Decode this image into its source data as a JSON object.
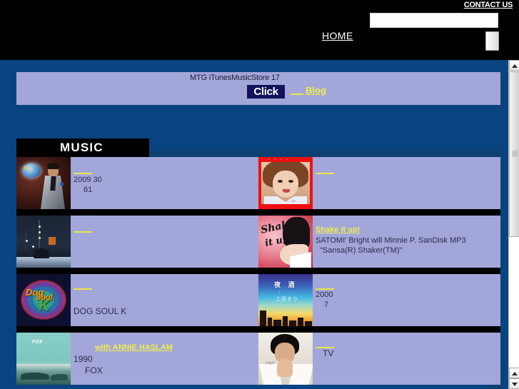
{
  "header": {
    "contact_label": "CONTACT US",
    "home_label": "HOME",
    "search_value": "",
    "search_placeholder": "",
    "go_label": ""
  },
  "banner": {
    "line1": "MTG  iTunesMusicStore        17",
    "click_label": "Click",
    "blog_label": "Blog"
  },
  "section": {
    "title": "MUSIC"
  },
  "rows": [
    {
      "left": {
        "art": "man-silver-suit",
        "link": "",
        "line1": "2009        30",
        "line2": "61"
      },
      "right": {
        "art": "idol-red-cd",
        "link": "",
        "line1": "",
        "line2": ""
      }
    },
    {
      "left": {
        "art": "concert-stage",
        "link": "",
        "line1": "",
        "line2": ""
      },
      "right": {
        "art": "shake-it-up-cd",
        "link": "Shake it up!",
        "line1": "SATOMI' Bright will           Minnie P.   SanDisk MP3",
        "line2": "\"Sansa(R) Shaker(TM)\""
      }
    },
    {
      "left": {
        "art": "dog-soul-k-logo",
        "link": "",
        "line1": "",
        "line2": "DOG  SOUL K"
      },
      "right": {
        "art": "sunset-city-cd",
        "link": "",
        "line1": "2000",
        "line2": "7"
      }
    },
    {
      "left": {
        "art": "fox-teal-cd",
        "link": "with ANNIE HASLAM",
        "line1": "1990",
        "line2": "FOX"
      },
      "right": {
        "art": "person-praying",
        "link": "",
        "line1": "TV",
        "line2": ""
      }
    }
  ],
  "colors": {
    "page_background": "#0a4480",
    "panel": "#a3a6d8",
    "header_bar": "#000000",
    "link_yellow": "#efef4e",
    "click_button": "#13135c",
    "strip": "#0e3f73"
  }
}
